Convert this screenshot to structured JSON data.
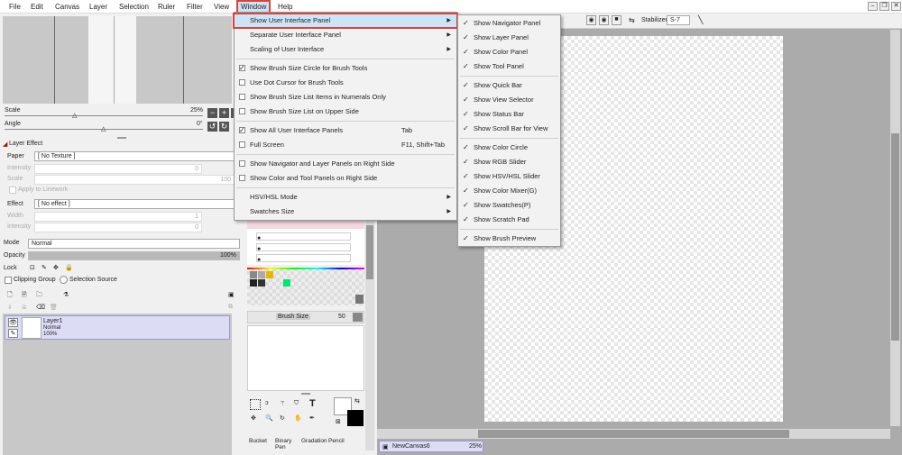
{
  "menubar": {
    "items": [
      "File",
      "Edit",
      "Canvas",
      "Layer",
      "Selection",
      "Ruler",
      "Filter",
      "View",
      "Window",
      "Help"
    ],
    "active": "Window"
  },
  "navigator": {
    "scale_label": "Scale",
    "scale_value": "25%",
    "angle_label": "Angle",
    "angle_value": "0°"
  },
  "layer_effect": {
    "header": "Layer Effect",
    "paper_label": "Paper",
    "paper_value": "[ No Texture ]",
    "intensity_label": "Intensity",
    "intensity_value": "0",
    "scale_label": "Scale",
    "scale_value": "100",
    "apply_linework": "Apply to Linework",
    "effect_label": "Effect",
    "effect_value": "[ No effect ]",
    "width_label": "Width",
    "width_value": "1",
    "intensity2_label": "Intensity",
    "intensity2_value": "0"
  },
  "layer_props": {
    "mode_label": "Mode",
    "mode_value": "Normal",
    "opacity_label": "Opacity",
    "opacity_value": "100%",
    "opacity_fraction": 1.0,
    "lock_label": "Lock",
    "clipping_label": "Clipping Group",
    "selection_source_label": "Selection Source"
  },
  "layers": [
    {
      "name": "Layer1",
      "mode": "Normal",
      "opacity": "100%"
    }
  ],
  "brush": {
    "size_label": "Brush Size",
    "size_value": "50"
  },
  "tools": {
    "labels": [
      "Bucket",
      "Binary Pen",
      "Gradation",
      "Pencil"
    ]
  },
  "toolbar2": {
    "stabilizer_label": "Stabilizer",
    "stabilizer_value": "S-7"
  },
  "status": {
    "canvas_name": "NewCanvas6",
    "zoom": "25%"
  },
  "window_menu": {
    "items": [
      {
        "label": "Show User Interface Panel",
        "type": "submenu"
      },
      {
        "label": "Separate User Interface Panel",
        "type": "submenu"
      },
      {
        "label": "Scaling of User Interface",
        "type": "submenu"
      },
      {
        "label": "Show Brush Size Circle for Brush Tools",
        "type": "check",
        "checked": true
      },
      {
        "label": "Use Dot Cursor for Brush Tools",
        "type": "check",
        "checked": false
      },
      {
        "label": "Show Brush Size List Items in Numerals Only",
        "type": "check",
        "checked": false
      },
      {
        "label": "Show Brush Size List on Upper Side",
        "type": "check",
        "checked": false
      },
      {
        "label": "Show All User Interface Panels",
        "type": "check",
        "checked": true,
        "shortcut": "Tab"
      },
      {
        "label": "Full Screen",
        "type": "check",
        "checked": false,
        "shortcut": "F11, Shift+Tab"
      },
      {
        "label": "Show Navigator and Layer Panels on Right Side",
        "type": "check",
        "checked": false
      },
      {
        "label": "Show Color and Tool Panels on Right Side",
        "type": "check",
        "checked": false
      },
      {
        "label": "HSV/HSL Mode",
        "type": "submenu"
      },
      {
        "label": "Swatches Size",
        "type": "submenu"
      }
    ]
  },
  "panel_submenu": {
    "items": [
      "Show Navigator Panel",
      "Show Layer Panel",
      "Show Color Panel",
      "Show Tool Panel",
      "Show Quick Bar",
      "Show View Selector",
      "Show Status Bar",
      "Show Scroll Bar for View",
      "Show Color Circle",
      "Show RGB Slider",
      "Show HSV/HSL Slider",
      "Show Color Mixer(G)",
      "Show Swatches(P)",
      "Show Scratch Pad",
      "Show Brush Preview"
    ]
  },
  "colors": {
    "highlight_red": "#d9443a",
    "menu_highlight": "#cce4f7",
    "layer_selected": "#dcdcf5",
    "swatch_yellow": "#e6b800",
    "swatch_green": "#00e676"
  }
}
